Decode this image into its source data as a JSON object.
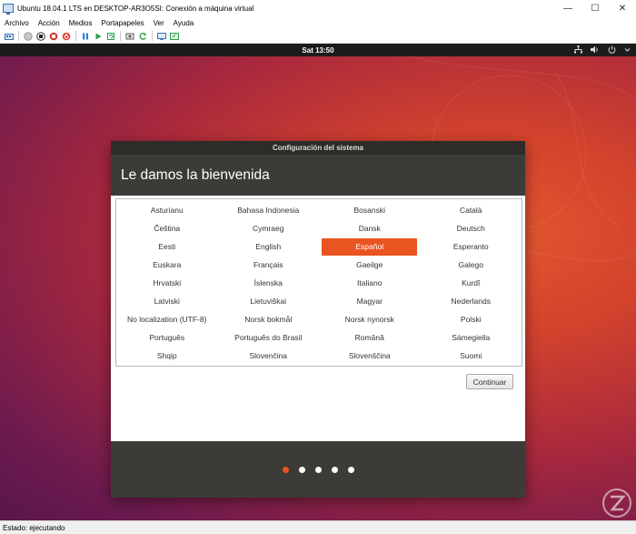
{
  "host": {
    "title": "Ubuntu 18.04.1 LTS en DESKTOP-AR3O5SI: Conexión a máquina virtual",
    "menu": [
      "Archivo",
      "Acción",
      "Medios",
      "Portapapeles",
      "Ver",
      "Ayuda"
    ],
    "status": "Estado: ejecutando"
  },
  "topbar": {
    "clock": "Sat 13:50"
  },
  "dialog": {
    "title": "Configuración del sistema",
    "heading": "Le damos la bienvenida",
    "languages": [
      "Asturianu",
      "Bahasa Indonesia",
      "Bosanski",
      "Català",
      "Čeština",
      "Cymraeg",
      "Dansk",
      "Deutsch",
      "Eesti",
      "English",
      "Español",
      "Esperanto",
      "Euskara",
      "Français",
      "Gaeilge",
      "Galego",
      "Hrvatski",
      "Íslenska",
      "Italiano",
      "Kurdî",
      "Latviski",
      "Lietuviškai",
      "Magyar",
      "Nederlands",
      "No localization (UTF-8)",
      "Norsk bokmål",
      "Norsk nynorsk",
      "Polski",
      "Português",
      "Português do Brasil",
      "Română",
      "Sámegiella",
      "Shqip",
      "Slovenčina",
      "Slovenščina",
      "Suomi"
    ],
    "selected_language": "Español",
    "continue_label": "Continuar",
    "pages_total": 5,
    "page_current": 1
  },
  "colors": {
    "accent": "#e95420",
    "dialog_bg": "#3c3b37",
    "topbar": "#1c1c1c"
  }
}
